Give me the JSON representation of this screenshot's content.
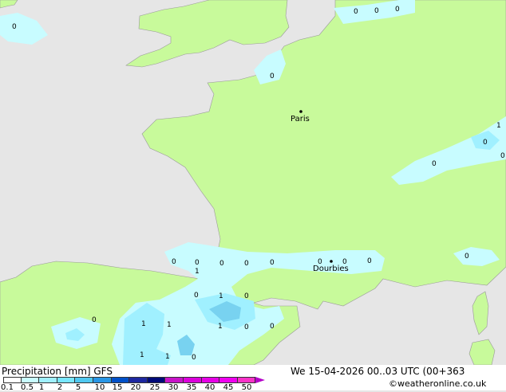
{
  "map": {
    "cities": [
      {
        "id": "paris",
        "name": "Paris"
      },
      {
        "id": "dourbies",
        "name": "Dourbies"
      }
    ],
    "precip_labels": [
      "0",
      "0",
      "0",
      "0",
      "0",
      "1",
      "0",
      "0",
      "0",
      "0",
      "0",
      "0",
      "0",
      "0",
      "0",
      "0",
      "0",
      "0",
      "1",
      "0",
      "0",
      "0",
      "1",
      "1",
      "1",
      "1",
      "0",
      "0",
      "1",
      "1",
      "0"
    ]
  },
  "footer": {
    "title": "Precipitation [mm]  GFS",
    "date": "We 15-04-2026 00..03 UTC (00+363",
    "credit": "©weatheronline.co.uk"
  },
  "legend": {
    "colors": [
      "#ffffff",
      "#c8fcff",
      "#a0f0ff",
      "#78e6ff",
      "#50c8f0",
      "#2896e6",
      "#0050c8",
      "#1e28a0",
      "#000a78",
      "#c814c8",
      "#dc00dc",
      "#e600e6",
      "#f000f0",
      "#fa32c8"
    ],
    "arrow_color": "#b400c8",
    "tick_labels": [
      "0.1",
      "0.5",
      "1",
      "2",
      "5",
      "10",
      "15",
      "20",
      "25",
      "30",
      "35",
      "40",
      "45",
      "50"
    ]
  },
  "colors": {
    "sea": "#e6e6e6",
    "land": "#c8fa9b",
    "precip_light": "#c8fcff",
    "precip_mid": "#a0f0ff",
    "precip_heavy": "#78d2f0"
  }
}
